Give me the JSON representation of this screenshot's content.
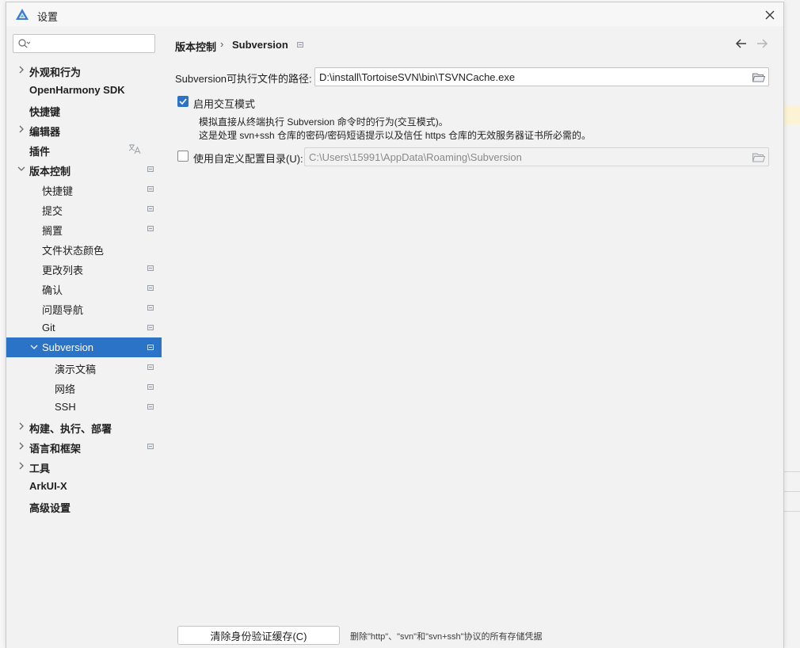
{
  "window": {
    "title": "设置",
    "close_icon": "close-icon",
    "app_icon": "deveco-logo-icon"
  },
  "sidebar": {
    "search": {
      "placeholder": "",
      "value": "",
      "icon": "search-icon"
    },
    "items": [
      {
        "label": "外观和行为",
        "bold": true,
        "expander": "collapsed",
        "level": 0
      },
      {
        "label": "OpenHarmony SDK",
        "bold": true,
        "level": 0
      },
      {
        "label": "快捷键",
        "bold": true,
        "level": 0
      },
      {
        "label": "编辑器",
        "bold": true,
        "expander": "collapsed",
        "level": 0
      },
      {
        "label": "插件",
        "bold": true,
        "level": 0,
        "icon": "translate-icon"
      },
      {
        "label": "版本控制",
        "bold": true,
        "expander": "expanded",
        "level": 0,
        "pinned": true
      },
      {
        "label": "快捷键",
        "level": 1,
        "pinned": true
      },
      {
        "label": "提交",
        "level": 1,
        "pinned": true
      },
      {
        "label": "搁置",
        "level": 1,
        "pinned": true
      },
      {
        "label": "文件状态颜色",
        "level": 1
      },
      {
        "label": "更改列表",
        "level": 1,
        "pinned": true
      },
      {
        "label": "确认",
        "level": 1,
        "pinned": true
      },
      {
        "label": "问题导航",
        "level": 1,
        "pinned": true
      },
      {
        "label": "Git",
        "level": 1,
        "pinned": true
      },
      {
        "label": "Subversion",
        "level": 1,
        "expander": "expanded",
        "pinned": true,
        "selected": true
      },
      {
        "label": "演示文稿",
        "level": 2,
        "pinned": true
      },
      {
        "label": "网络",
        "level": 2,
        "pinned": true
      },
      {
        "label": "SSH",
        "level": 2,
        "pinned": true
      },
      {
        "label": "构建、执行、部署",
        "bold": true,
        "expander": "collapsed",
        "level": 0
      },
      {
        "label": "语言和框架",
        "bold": true,
        "expander": "collapsed",
        "level": 0,
        "pinned": true
      },
      {
        "label": "工具",
        "bold": true,
        "expander": "collapsed",
        "level": 0
      },
      {
        "label": "ArkUI-X",
        "bold": true,
        "level": 0
      },
      {
        "label": "高级设置",
        "bold": true,
        "level": 0
      }
    ]
  },
  "main": {
    "breadcrumb": {
      "parent": "版本控制",
      "separator": "›",
      "current": "Subversion"
    },
    "nav": {
      "back_icon": "arrow-left-icon",
      "forward_icon": "arrow-right-icon"
    },
    "exe_path": {
      "label": "Subversion可执行文件的路径:",
      "value": "D:\\install\\TortoiseSVN\\bin\\TSVNCache.exe",
      "browse_icon": "folder-icon"
    },
    "interactive_mode": {
      "checked": true,
      "label": "启用交互模式",
      "desc_line1": "模拟直接从终端执行 Subversion 命令时的行为(交互模式)。",
      "desc_line2": "这是处理 svn+ssh 仓库的密码/密码短语提示以及信任 https 仓库的无效服务器证书所必需的。"
    },
    "custom_config": {
      "checked": false,
      "label": "使用自定义配置目录(U):",
      "value": "C:\\Users\\15991\\AppData\\Roaming\\Subversion",
      "browse_icon": "folder-icon"
    },
    "clear_cache": {
      "button_label": "清除身份验证缓存(C)",
      "note": "删除\"http\"、\"svn\"和\"svn+ssh\"协议的所有存储凭据"
    }
  },
  "colors": {
    "accent": "#2a73c6",
    "panel_bg": "#f2f2f2"
  }
}
